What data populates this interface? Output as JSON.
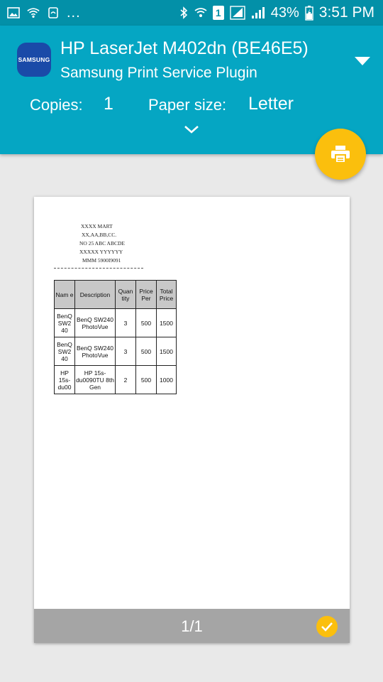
{
  "status_bar": {
    "dots": "...",
    "battery": "43%",
    "time": "3:51 PM",
    "sim_number": "1",
    "icons": [
      "image-icon",
      "wifi-icon",
      "screen-rotation-icon",
      "bluetooth-icon",
      "wifi-signal-icon",
      "sim-icon",
      "cell-signal-icon",
      "battery-charging-icon"
    ]
  },
  "header": {
    "logo_text": "SAMSUNG",
    "printer_name": "HP LaserJet M402dn (BE46E5)",
    "plugin_name": "Samsung Print Service Plugin",
    "copies_label": "Copies:",
    "copies_value": "1",
    "paper_size_label": "Paper size:",
    "paper_size_value": "Letter"
  },
  "receipt": {
    "lines": [
      "XXXX MART",
      "XX,AA,BB,CC.",
      "NO 25 ABC ABCDE",
      "XXXXX YYYYYY",
      "MMM 5900I9091"
    ],
    "table": {
      "headers": [
        "Nam e",
        "Description",
        "Quan tity",
        "Price Per",
        "Total Price"
      ],
      "rows": [
        [
          "BenQ SW2 40",
          "BenQ SW240 PhotoVue",
          "3",
          "500",
          "1500"
        ],
        [
          "BenQ SW2 40",
          "BenQ SW240 PhotoVue",
          "3",
          "500",
          "1500"
        ],
        [
          "HP 15s- du00",
          "HP 15s- du0090TU 8th Gen",
          "2",
          "500",
          "1000"
        ]
      ]
    }
  },
  "footer": {
    "page_count": "1/1"
  },
  "colors": {
    "status_bar": "#0390a8",
    "header": "#05a6c3",
    "accent": "#fbbf0d",
    "footer": "#a5a5a5"
  }
}
